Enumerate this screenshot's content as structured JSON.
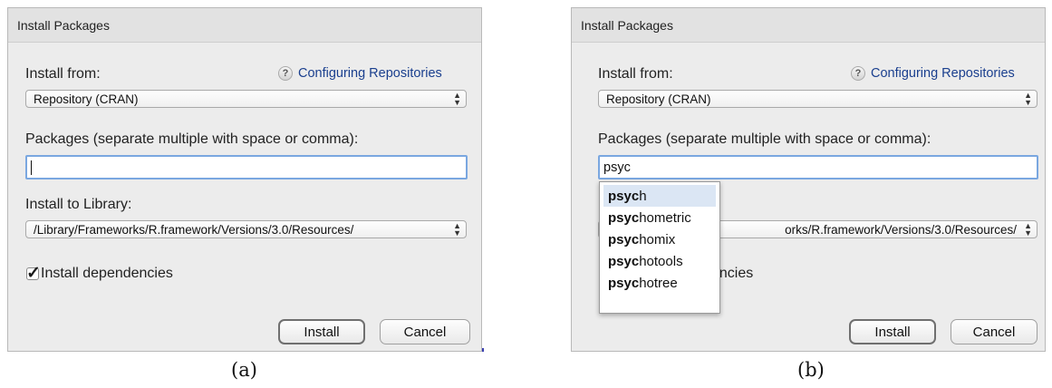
{
  "panels": [
    {
      "caption": "(a)",
      "dialog": {
        "title": "Install Packages",
        "install_from_label": "Install from:",
        "help_link": "Configuring Repositories",
        "help_icon": "?",
        "repository_value": "Repository (CRAN)",
        "packages_label": "Packages (separate multiple with space or comma):",
        "packages_value": "",
        "library_label": "Install to Library:",
        "library_value": "/Library/Frameworks/R.framework/Versions/3.0/Resources/",
        "dependencies_label": "Install dependencies",
        "dependencies_checked": true,
        "install_button": "Install",
        "cancel_button": "Cancel"
      }
    },
    {
      "caption": "(b)",
      "dialog": {
        "title": "Install Packages",
        "install_from_label": "Install from:",
        "help_link": "Configuring Repositories",
        "help_icon": "?",
        "repository_value": "Repository (CRAN)",
        "packages_label": "Packages (separate multiple with space or comma):",
        "packages_value": "psyc",
        "library_label_fragment": "I",
        "library_value_visible": "orks/R.framework/Versions/3.0/Resources/",
        "dependencies_label_fragment": "encies",
        "install_button": "Install",
        "cancel_button": "Cancel",
        "autocomplete": {
          "match_prefix": "psyc",
          "selected_index": 0,
          "suggestions": [
            {
              "match": "psyc",
              "rest": "h"
            },
            {
              "match": "psyc",
              "rest": "hometric"
            },
            {
              "match": "psyc",
              "rest": "homix"
            },
            {
              "match": "psyc",
              "rest": "hotools"
            },
            {
              "match": "psyc",
              "rest": "hotree"
            }
          ]
        }
      }
    }
  ],
  "colors": {
    "dialog_bg": "#ececec",
    "link": "#1a3f8e",
    "focus_border": "#7aa7e0",
    "selected_suggestion": "#dbe6f4"
  },
  "icons": [
    "help-icon",
    "select-stepper-icon",
    "checkmark-icon"
  ]
}
